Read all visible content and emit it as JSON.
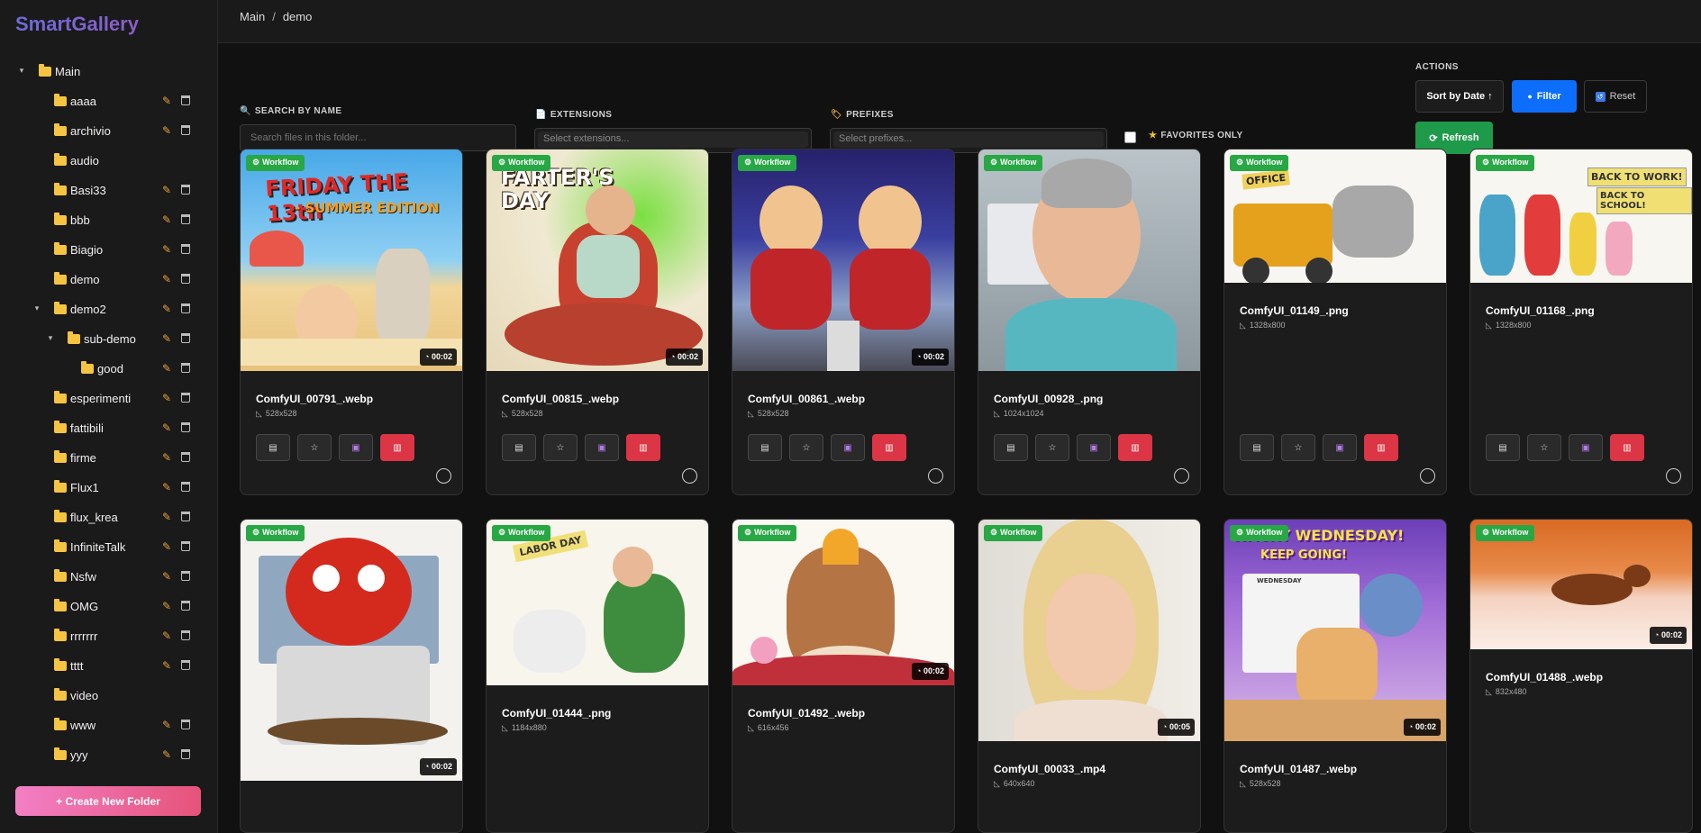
{
  "app": {
    "title": "SmartGallery"
  },
  "sidebar": {
    "items": [
      {
        "label": "Main",
        "level": 0,
        "expanded": true,
        "actions": false
      },
      {
        "label": "aaaa",
        "level": 1,
        "actions": true
      },
      {
        "label": "archivio",
        "level": 1,
        "actions": true
      },
      {
        "label": "audio",
        "level": 1,
        "actions": false
      },
      {
        "label": "Basi33",
        "level": 1,
        "actions": true
      },
      {
        "label": "bbb",
        "level": 1,
        "actions": true
      },
      {
        "label": "Biagio",
        "level": 1,
        "actions": true
      },
      {
        "label": "demo",
        "level": 1,
        "actions": true
      },
      {
        "label": "demo2",
        "level": 1,
        "expanded": true,
        "actions": true
      },
      {
        "label": "sub-demo",
        "level": 2,
        "expanded": true,
        "actions": true
      },
      {
        "label": "good",
        "level": 3,
        "actions": true
      },
      {
        "label": "esperimenti",
        "level": 1,
        "actions": true
      },
      {
        "label": "fattibili",
        "level": 1,
        "actions": true
      },
      {
        "label": "firme",
        "level": 1,
        "actions": true
      },
      {
        "label": "Flux1",
        "level": 1,
        "actions": true
      },
      {
        "label": "flux_krea",
        "level": 1,
        "actions": true
      },
      {
        "label": "InfiniteTalk",
        "level": 1,
        "actions": true
      },
      {
        "label": "Nsfw",
        "level": 1,
        "actions": true
      },
      {
        "label": "OMG",
        "level": 1,
        "actions": true
      },
      {
        "label": "rrrrrrr",
        "level": 1,
        "actions": true
      },
      {
        "label": "tttt",
        "level": 1,
        "actions": true
      },
      {
        "label": "video",
        "level": 1,
        "actions": false
      },
      {
        "label": "www",
        "level": 1,
        "actions": true
      },
      {
        "label": "yyy",
        "level": 1,
        "actions": true
      }
    ],
    "create_button": "+ Create New Folder"
  },
  "breadcrumb": {
    "root": "Main",
    "sep": "/",
    "current": "demo"
  },
  "filters": {
    "search_label": "SEARCH BY NAME",
    "search_placeholder": "Search files in this folder...",
    "extensions_label": "EXTENSIONS",
    "extensions_placeholder": "Select extensions...",
    "prefixes_label": "PREFIXES",
    "prefixes_placeholder": "Select prefixes...",
    "favorites_label": "FAVORITES ONLY",
    "favorites_checked": false
  },
  "actions": {
    "label": "ACTIONS",
    "sort": "Sort by Date ↑",
    "filter": "Filter",
    "reset": "Reset",
    "refresh": "Refresh"
  },
  "cards": [
    {
      "name": "ComfyUI_00791_.webp",
      "dims": "528x528",
      "workflow": "Workflow",
      "duration": "00:02",
      "scene": "friday"
    },
    {
      "name": "ComfyUI_00815_.webp",
      "dims": "528x528",
      "workflow": "Workflow",
      "duration": "00:02",
      "scene": "farter"
    },
    {
      "name": "ComfyUI_00861_.webp",
      "dims": "528x528",
      "workflow": "Workflow",
      "duration": "00:02",
      "scene": "parade"
    },
    {
      "name": "ComfyUI_00928_.png",
      "dims": "1024x1024",
      "workflow": "Workflow",
      "duration": "",
      "scene": "man"
    },
    {
      "name": "ComfyUI_01149_.png",
      "dims": "1328x800",
      "workflow": "Workflow",
      "duration": "",
      "scene": "office"
    },
    {
      "name": "ComfyUI_01168_.png",
      "dims": "1328x800",
      "workflow": "Workflow",
      "duration": "",
      "scene": "school"
    },
    {
      "name": "",
      "dims": "",
      "workflow": "Workflow",
      "duration": "00:02",
      "scene": "heart"
    },
    {
      "name": "ComfyUI_01444_.png",
      "dims": "1184x880",
      "workflow": "Workflow",
      "duration": "",
      "scene": "labor"
    },
    {
      "name": "ComfyUI_01492_.webp",
      "dims": "616x456",
      "workflow": "Workflow",
      "duration": "00:02",
      "scene": "cake"
    },
    {
      "name": "ComfyUI_00033_.mp4",
      "dims": "640x640",
      "workflow": "Workflow",
      "duration": "00:05",
      "scene": "woman"
    },
    {
      "name": "ComfyUI_01487_.webp",
      "dims": "528x528",
      "workflow": "Workflow",
      "duration": "00:02",
      "scene": "wednesday"
    },
    {
      "name": "ComfyUI_01488_.webp",
      "dims": "832x480",
      "workflow": "Workflow",
      "duration": "00:02",
      "scene": "fox"
    }
  ],
  "card_actions": {
    "doc_icon": "document-icon",
    "star_icon": "star-icon",
    "save_icon": "save-icon",
    "delete_icon": "trash-icon"
  },
  "thumb_text": {
    "friday": "FRIDAY THE 13th",
    "friday_sub": "- SUMMER EDITION",
    "farter": "FARTER'S DAY",
    "office": "OFFICE",
    "school_1": "BACK TO WORK!",
    "school_2": "BACK TO SCHOOL!",
    "labor": "LABOR DAY",
    "wednesday_1": "WACKY WEDNESDAY!",
    "wednesday_2": "KEEP GOING!",
    "wednesday_cal": "WEDNESDAY"
  }
}
